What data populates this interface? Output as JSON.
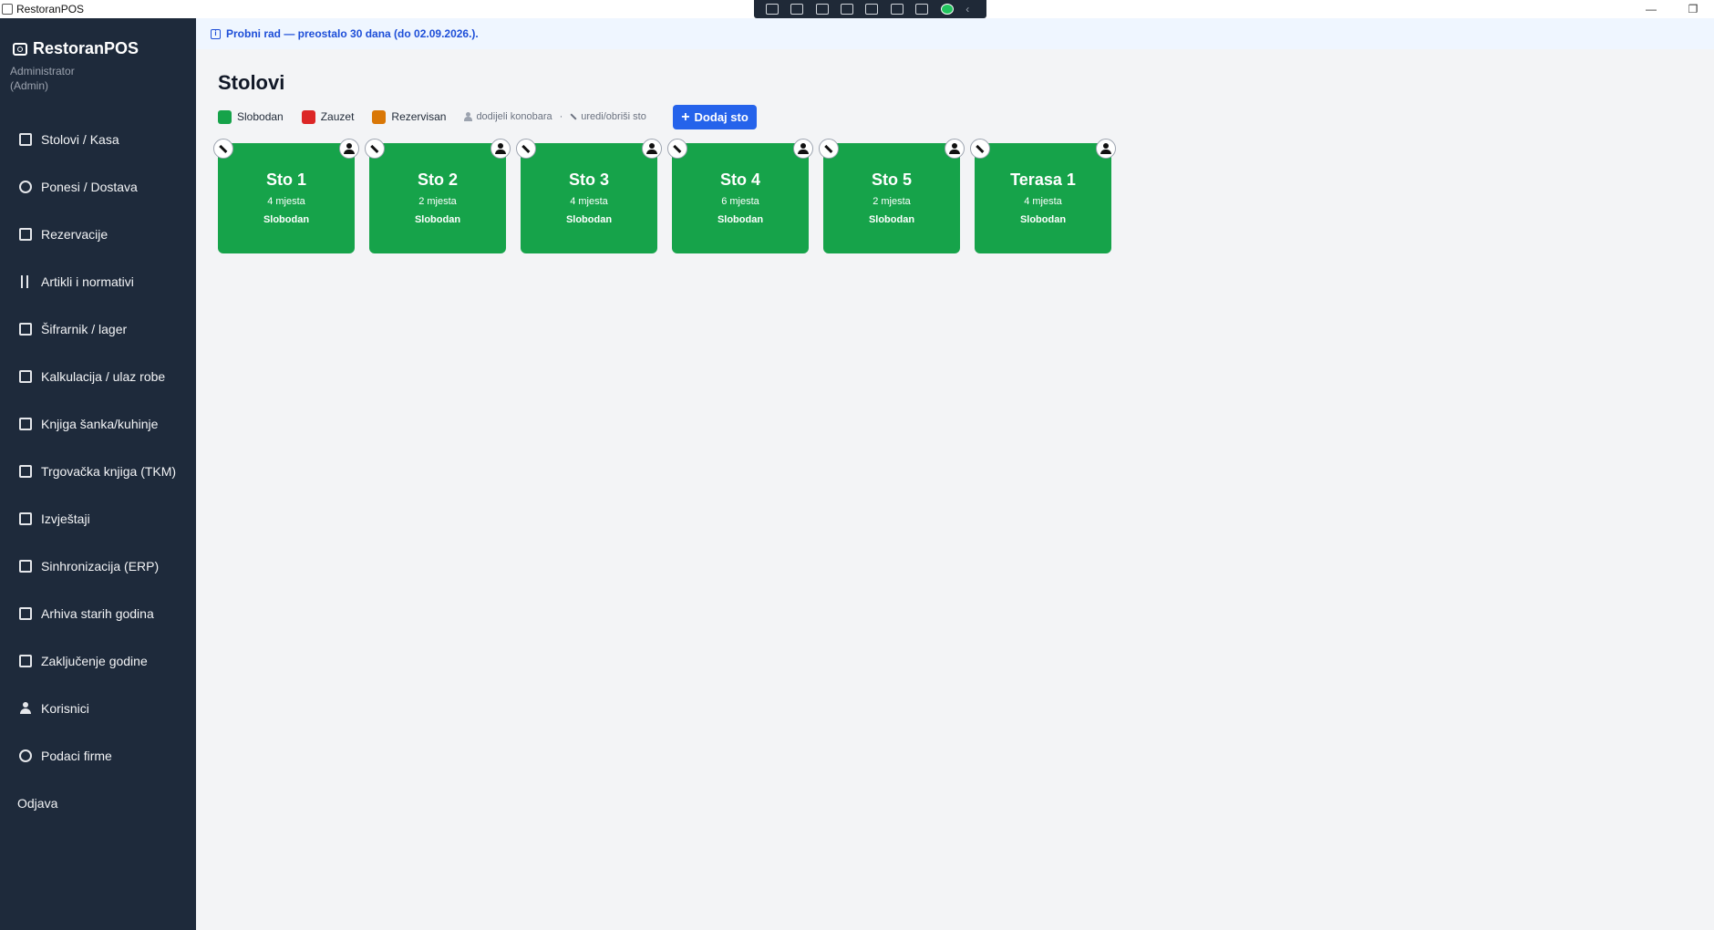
{
  "window": {
    "title": "RestoranPOS",
    "minimize": "—",
    "restore": "❐"
  },
  "sidebar": {
    "brand": "RestoranPOS",
    "user_name": "Administrator",
    "user_role": "(Admin)",
    "items": [
      {
        "label": "Stolovi / Kasa",
        "icon": "cash-register-icon"
      },
      {
        "label": "Ponesi / Dostava",
        "icon": "delivery-icon"
      },
      {
        "label": "Rezervacije",
        "icon": "calendar-icon"
      },
      {
        "label": "Artikli i normativi",
        "icon": "fork-knife-icon"
      },
      {
        "label": "Šifrarnik / lager",
        "icon": "box-icon"
      },
      {
        "label": "Kalkulacija / ulaz robe",
        "icon": "truck-icon"
      },
      {
        "label": "Knjiga šanka/kuhinje",
        "icon": "book-icon"
      },
      {
        "label": "Trgovačka knjiga (TKM)",
        "icon": "ledger-icon"
      },
      {
        "label": "Izvještaji",
        "icon": "bar-chart-icon"
      },
      {
        "label": "Sinhronizacija (ERP)",
        "icon": "sync-icon"
      },
      {
        "label": "Arhiva starih godina",
        "icon": "archive-icon"
      },
      {
        "label": "Zaključenje godine",
        "icon": "calendar-lock-icon"
      },
      {
        "label": "Korisnici",
        "icon": "user-icon"
      },
      {
        "label": "Podaci firme",
        "icon": "gear-icon"
      }
    ],
    "logout": "Odjava"
  },
  "banner": {
    "text": "Probni rad — preostalo 30 dana (do 02.09.2026.)."
  },
  "page": {
    "title": "Stolovi",
    "legend": {
      "free": "Slobodan",
      "occupied": "Zauzet",
      "reserved": "Rezervisan",
      "hint_assign": "dodijeli konobara",
      "hint_sep": "·",
      "hint_edit": "uredi/obriši sto"
    },
    "add_button": "Dodaj sto"
  },
  "colors": {
    "free": "#16a34a",
    "occupied": "#dc2626",
    "reserved": "#d97706",
    "accent": "#2563eb",
    "sidebar": "#1e2a3b"
  },
  "tables": [
    {
      "name": "Sto 1",
      "seats": "4 mjesta",
      "status": "Slobodan"
    },
    {
      "name": "Sto 2",
      "seats": "2 mjesta",
      "status": "Slobodan"
    },
    {
      "name": "Sto 3",
      "seats": "4 mjesta",
      "status": "Slobodan"
    },
    {
      "name": "Sto 4",
      "seats": "6 mjesta",
      "status": "Slobodan"
    },
    {
      "name": "Sto 5",
      "seats": "2 mjesta",
      "status": "Slobodan"
    },
    {
      "name": "Terasa 1",
      "seats": "4 mjesta",
      "status": "Slobodan"
    }
  ]
}
